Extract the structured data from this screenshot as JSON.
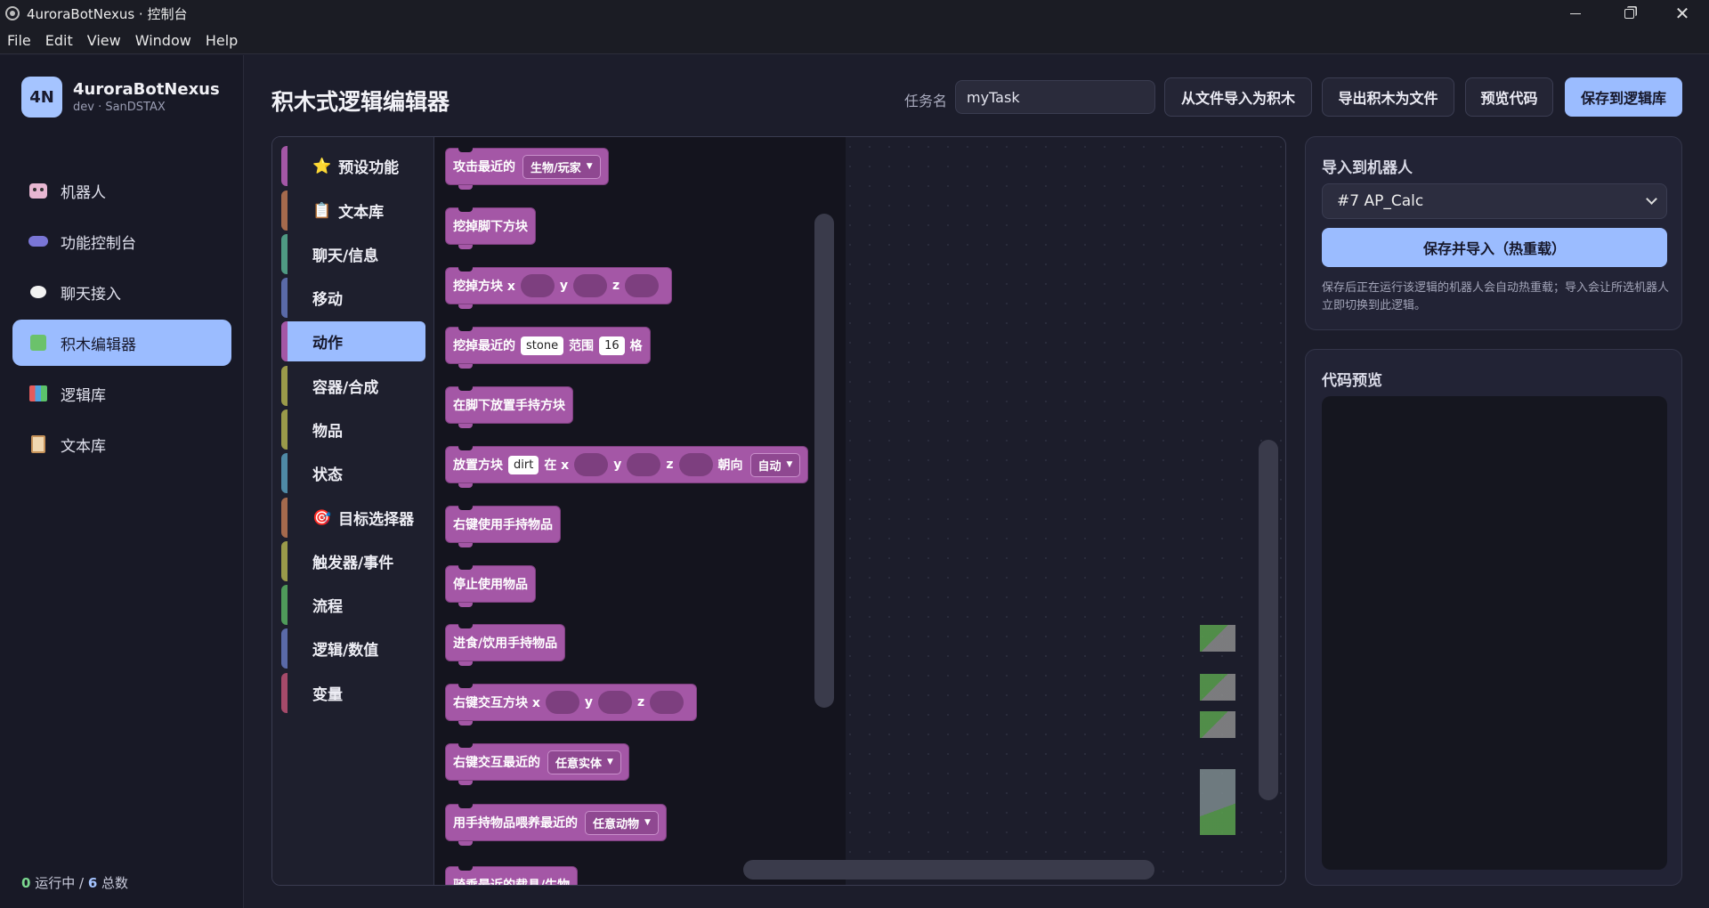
{
  "window": {
    "title": "4uroraBotNexus · 控制台"
  },
  "menu": [
    "File",
    "Edit",
    "View",
    "Window",
    "Help"
  ],
  "brand": {
    "logo": "4N",
    "name": "4uroraBotNexus",
    "sub": "dev · SanDSTAX"
  },
  "nav": [
    {
      "label": "机器人",
      "icon": "robot-icon"
    },
    {
      "label": "功能控制台",
      "icon": "gamepad-icon"
    },
    {
      "label": "聊天接入",
      "icon": "chat-bubble-icon"
    },
    {
      "label": "积木编辑器",
      "icon": "puzzle-icon",
      "active": true
    },
    {
      "label": "逻辑库",
      "icon": "books-icon"
    },
    {
      "label": "文本库",
      "icon": "clipboard-icon"
    }
  ],
  "footer": {
    "running": "0",
    "running_label": "运行中 /",
    "total": "6",
    "total_label": "总数"
  },
  "header": {
    "title": "积木式逻辑编辑器",
    "task_label": "任务名",
    "task_value": "myTask",
    "btn_import_file": "从文件导入为积木",
    "btn_export": "导出积木为文件",
    "btn_preview": "预览代码",
    "btn_save": "保存到逻辑库"
  },
  "categories": [
    {
      "label": "预设功能",
      "icon": "⭐",
      "color": "#a457a6"
    },
    {
      "label": "文本库",
      "icon": "📋",
      "color": "#a56a4d"
    },
    {
      "label": "聊天/信息",
      "icon": "",
      "color": "#4f9a83"
    },
    {
      "label": "移动",
      "icon": "",
      "color": "#5a6aa8"
    },
    {
      "label": "动作",
      "icon": "",
      "color": "#a457a6",
      "active": true
    },
    {
      "label": "容器/合成",
      "icon": "",
      "color": "#9a9a4a"
    },
    {
      "label": "物品",
      "icon": "",
      "color": "#9a9a4a"
    },
    {
      "label": "状态",
      "icon": "",
      "color": "#4f8aa6"
    },
    {
      "label": "目标选择器",
      "icon": "🎯",
      "color": "#a56a4d"
    },
    {
      "label": "触发器/事件",
      "icon": "",
      "color": "#9a9a4a"
    },
    {
      "label": "流程",
      "icon": "",
      "color": "#4f9a5a"
    },
    {
      "label": "逻辑/数值",
      "icon": "",
      "color": "#5a6aa8"
    },
    {
      "label": "变量",
      "icon": "",
      "color": "#a54a6a"
    }
  ],
  "blocks": {
    "b1": {
      "text": "攻击最近的",
      "dd": "生物/玩家"
    },
    "b2": {
      "text": "挖掉脚下方块"
    },
    "b3": {
      "text": "挖掉方块 x",
      "y": "y",
      "z": "z"
    },
    "b4": {
      "text": "挖掉最近的",
      "field": "stone",
      "range": "范围",
      "num": "16",
      "unit": "格"
    },
    "b5": {
      "text": "在脚下放置手持方块"
    },
    "b6": {
      "text": "放置方块",
      "field": "dirt",
      "at": "在 x",
      "y": "y",
      "z": "z",
      "dir": "朝向",
      "dd": "自动"
    },
    "b7": {
      "text": "右键使用手持物品"
    },
    "b8": {
      "text": "停止使用物品"
    },
    "b9": {
      "text": "进食/饮用手持物品"
    },
    "b10": {
      "text": "右键交互方块 x",
      "y": "y",
      "z": "z"
    },
    "b11": {
      "text": "右键交互最近的",
      "dd": "任意实体"
    },
    "b12": {
      "text": "用手持物品喂养最近的",
      "dd": "任意动物"
    },
    "b13": {
      "text": "骑乘最近的载具/生物"
    }
  },
  "import_panel": {
    "title": "导入到机器人",
    "selected_bot": "#7 AP_Calc",
    "button": "保存并导入（热重载）",
    "hint": "保存后正在运行该逻辑的机器人会自动热重载；导入会让所选机器人立即切换到此逻辑。"
  },
  "code_panel": {
    "title": "代码预览",
    "code": ""
  },
  "colors": {
    "accent": "#9bbcff",
    "block": "#a457a6",
    "background": "#1c1d2b"
  }
}
